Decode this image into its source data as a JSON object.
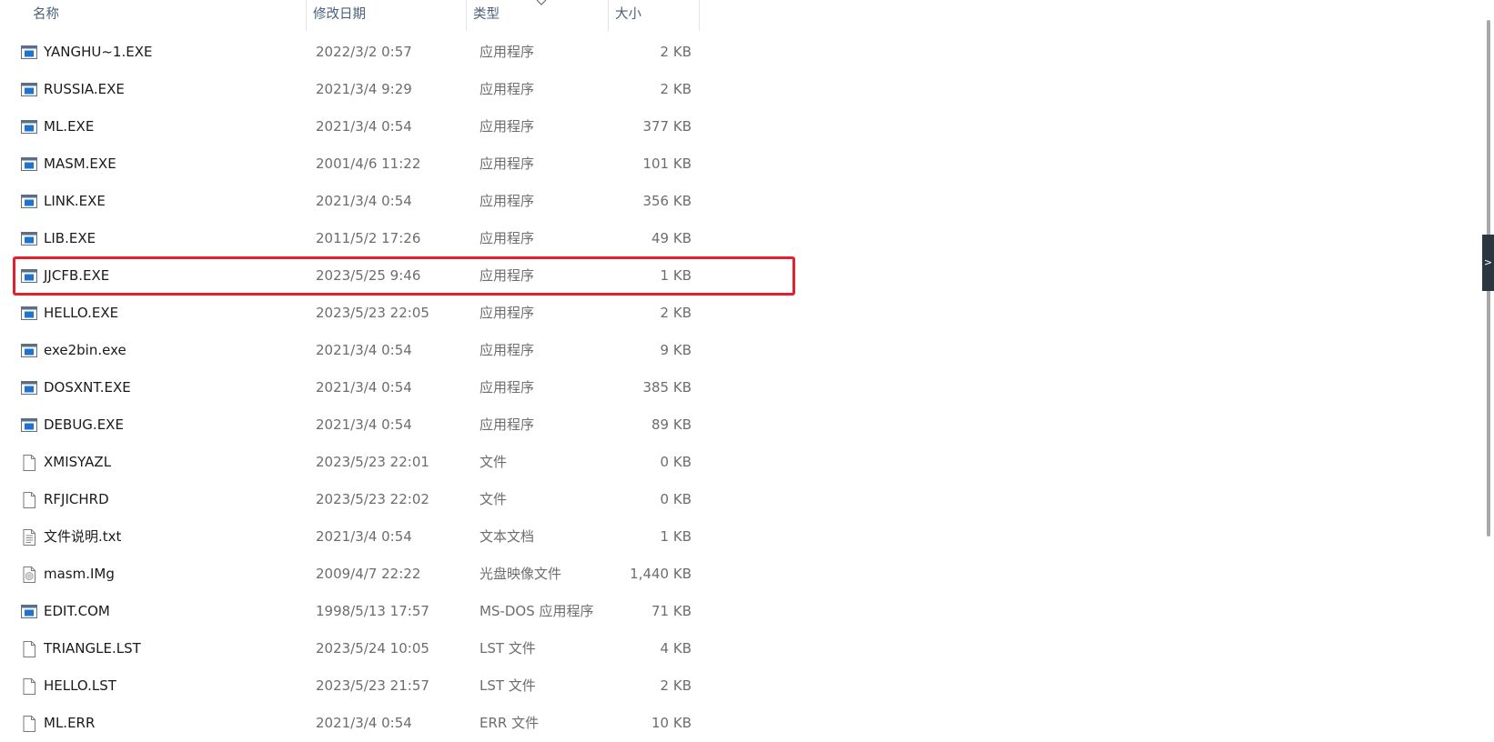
{
  "columns": {
    "name": "名称",
    "date": "修改日期",
    "type": "类型",
    "size": "大小"
  },
  "files": [
    {
      "name": "YANGHU~1.EXE",
      "date": "2022/3/2 0:57",
      "type": "应用程序",
      "size": "2 KB",
      "icon": "exe"
    },
    {
      "name": "RUSSIA.EXE",
      "date": "2021/3/4 9:29",
      "type": "应用程序",
      "size": "2 KB",
      "icon": "exe"
    },
    {
      "name": "ML.EXE",
      "date": "2021/3/4 0:54",
      "type": "应用程序",
      "size": "377 KB",
      "icon": "exe"
    },
    {
      "name": "MASM.EXE",
      "date": "2001/4/6 11:22",
      "type": "应用程序",
      "size": "101 KB",
      "icon": "exe"
    },
    {
      "name": "LINK.EXE",
      "date": "2021/3/4 0:54",
      "type": "应用程序",
      "size": "356 KB",
      "icon": "exe"
    },
    {
      "name": "LIB.EXE",
      "date": "2011/5/2 17:26",
      "type": "应用程序",
      "size": "49 KB",
      "icon": "exe"
    },
    {
      "name": "JJCFB.EXE",
      "date": "2023/5/25 9:46",
      "type": "应用程序",
      "size": "1 KB",
      "icon": "exe"
    },
    {
      "name": "HELLO.EXE",
      "date": "2023/5/23 22:05",
      "type": "应用程序",
      "size": "2 KB",
      "icon": "exe"
    },
    {
      "name": "exe2bin.exe",
      "date": "2021/3/4 0:54",
      "type": "应用程序",
      "size": "9 KB",
      "icon": "exe"
    },
    {
      "name": "DOSXNT.EXE",
      "date": "2021/3/4 0:54",
      "type": "应用程序",
      "size": "385 KB",
      "icon": "exe"
    },
    {
      "name": "DEBUG.EXE",
      "date": "2021/3/4 0:54",
      "type": "应用程序",
      "size": "89 KB",
      "icon": "exe"
    },
    {
      "name": "XMISYAZL",
      "date": "2023/5/23 22:01",
      "type": "文件",
      "size": "0 KB",
      "icon": "file"
    },
    {
      "name": "RFJICHRD",
      "date": "2023/5/23 22:02",
      "type": "文件",
      "size": "0 KB",
      "icon": "file"
    },
    {
      "name": "文件说明.txt",
      "date": "2021/3/4 0:54",
      "type": "文本文档",
      "size": "1 KB",
      "icon": "txt"
    },
    {
      "name": "masm.IMg",
      "date": "2009/4/7 22:22",
      "type": "光盘映像文件",
      "size": "1,440 KB",
      "icon": "img"
    },
    {
      "name": "EDIT.COM",
      "date": "1998/5/13 17:57",
      "type": "MS-DOS 应用程序",
      "size": "71 KB",
      "icon": "exe"
    },
    {
      "name": "TRIANGLE.LST",
      "date": "2023/5/24 10:05",
      "type": "LST 文件",
      "size": "4 KB",
      "icon": "file"
    },
    {
      "name": "HELLO.LST",
      "date": "2023/5/23 21:57",
      "type": "LST 文件",
      "size": "2 KB",
      "icon": "file"
    },
    {
      "name": "ML.ERR",
      "date": "2021/3/4 0:54",
      "type": "ERR 文件",
      "size": "10 KB",
      "icon": "file"
    }
  ],
  "highlighted_file": "JJCFB.EXE",
  "side_tab_glyph": ">",
  "colors": {
    "highlight": "#e4202f",
    "header_text": "#4c607a",
    "exe_icon_blue": "#1d73d1"
  }
}
